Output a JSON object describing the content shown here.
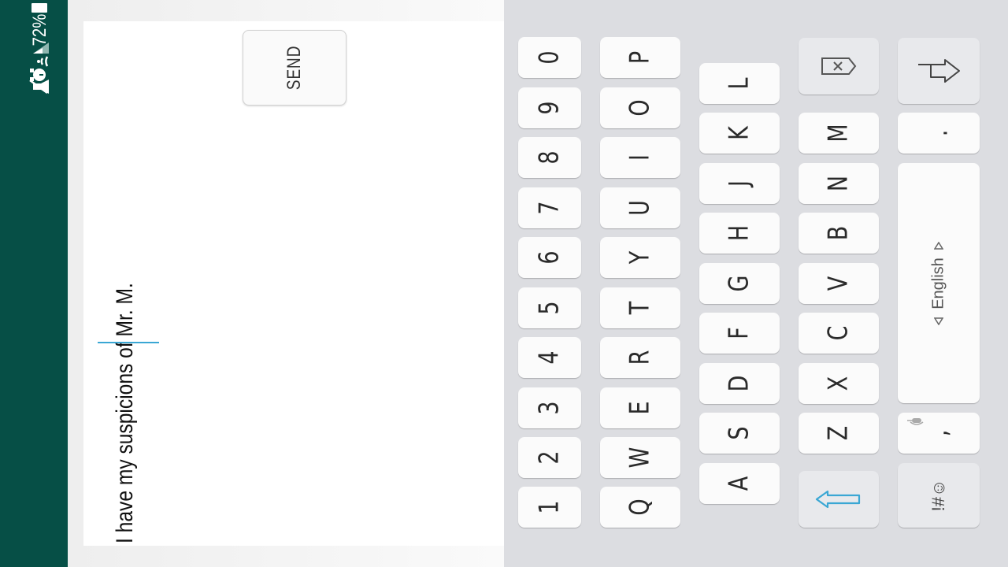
{
  "status_bar": {
    "battery_percent": "72%",
    "battery_level": 0.72,
    "icons": [
      "mute-icon",
      "alarm-icon",
      "wifi-icon",
      "signal-icon",
      "battery-icon"
    ]
  },
  "compose": {
    "send_label": "SEND",
    "message_value": "I have my suspicions of Mr. M."
  },
  "keyboard": {
    "number_row": [
      "1",
      "2",
      "3",
      "4",
      "5",
      "6",
      "7",
      "8",
      "9",
      "0"
    ],
    "row_q": [
      "Q",
      "W",
      "E",
      "R",
      "T",
      "Y",
      "U",
      "I",
      "O",
      "P"
    ],
    "row_a": [
      "A",
      "S",
      "D",
      "F",
      "G",
      "H",
      "J",
      "K",
      "L"
    ],
    "row_z": [
      "Z",
      "X",
      "C",
      "V",
      "B",
      "N",
      "M"
    ],
    "space_label": "English",
    "period_label": ".",
    "comma_label": ",",
    "symbols_label": "!#☺",
    "icons": [
      "shift-icon",
      "backspace-icon",
      "enter-icon",
      "mic-icon"
    ],
    "accent_color": "#3aa7d4"
  },
  "colors": {
    "status_bar": "#064f46",
    "keyboard_bg": "#dcdde1",
    "key_bg": "#fbfbfb"
  }
}
